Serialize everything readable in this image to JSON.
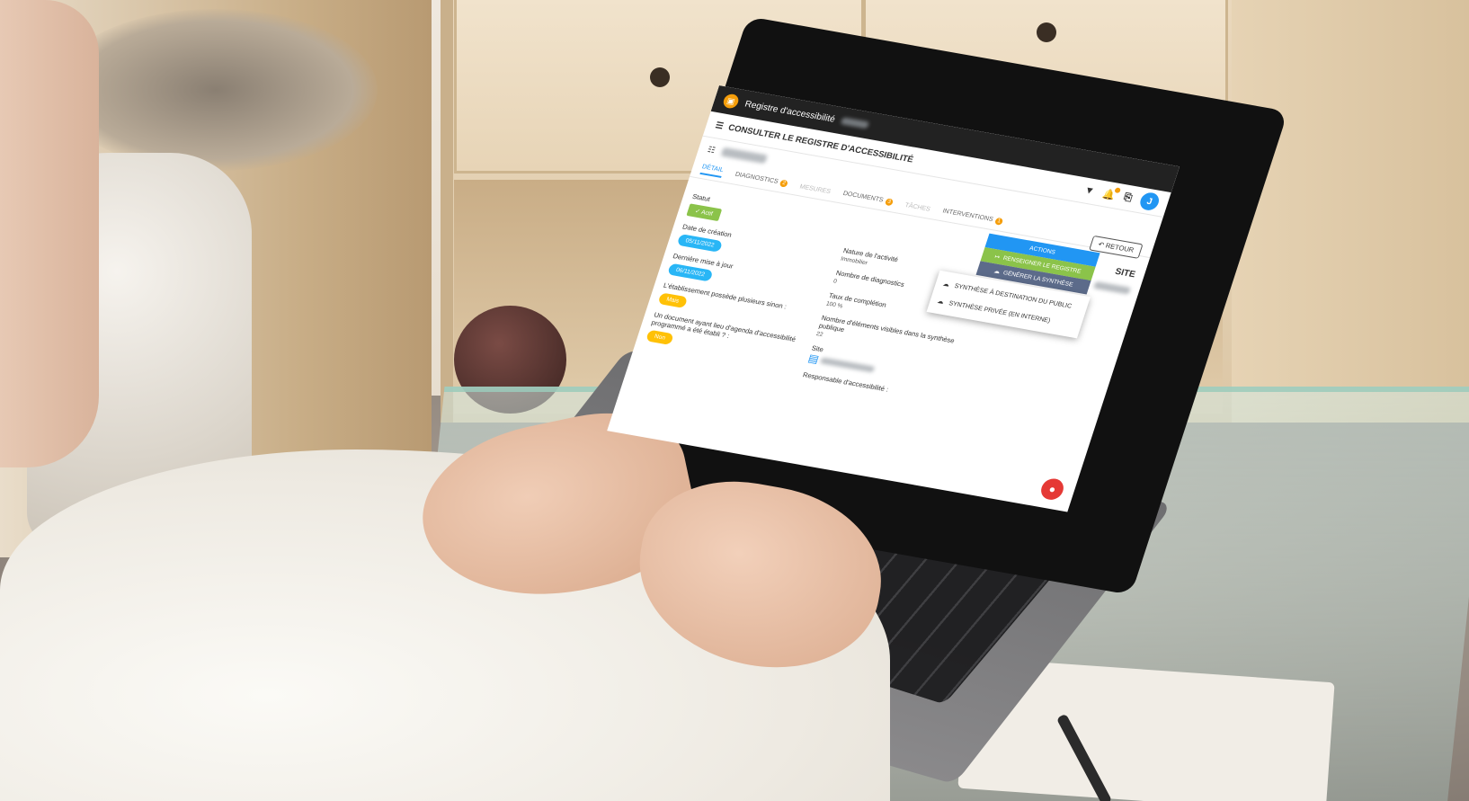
{
  "app": {
    "title": "Registre d'accessibilité",
    "logo_glyph": "▣"
  },
  "header": {
    "page_title": "CONSULTER LE REGISTRE D'ACCESSIBILITÉ",
    "avatar_letter": "J",
    "notification_count": "1",
    "colors": {
      "accent": "#2196f3",
      "warning": "#f59e0b"
    }
  },
  "tabs": [
    {
      "label": "Détail",
      "state": "active"
    },
    {
      "label": "Diagnostics",
      "count": "2"
    },
    {
      "label": "Mesures",
      "state": "disabled"
    },
    {
      "label": "Documents",
      "count": "3"
    },
    {
      "label": "Tâches",
      "state": "disabled"
    },
    {
      "label": "Interventions",
      "count": "1"
    }
  ],
  "retour_label": "RETOUR",
  "detail": {
    "statut_label": "Statut",
    "statut_value": "✓ Actif",
    "creation_label": "Date de création",
    "creation_value": "05/11/2022",
    "maj_label": "Dernière mise à jour",
    "maj_value": "06/11/2022",
    "sinon_label": "L'établissement possède plusieurs sinon :",
    "sinon_value": "Mais",
    "agenda_label": "Un document ayant lieu d'agenda d'accessibilité programmé a été établi ? :",
    "agenda_value": "Non"
  },
  "middle": {
    "nature_label": "Nature de l'activité",
    "nature_value": "Immobilier",
    "nb_diag_label": "Nombre de diagnostics",
    "nb_diag_value": "0",
    "taux_label": "Taux de complétion",
    "taux_value": "100 %",
    "elements_label": "Nombre d'éléments visibles dans la synthèse publique",
    "elements_value": "22",
    "site_label": "Site",
    "responsable_label": "Responsable d'accessibilité :"
  },
  "right": {
    "site_heading": "SITE"
  },
  "actions": {
    "actions_label": "ACTIONS",
    "renseigner_label": "RENSEIGNER LE REGISTRE",
    "generer_label": "GÉNÉRER LA SYNTHÈSE"
  },
  "synthese_menu": [
    "SYNTHÈSE À DESTINATION DU PUBLIC",
    "SYNTHÈSE PRIVÉE (EN INTERNE)"
  ]
}
